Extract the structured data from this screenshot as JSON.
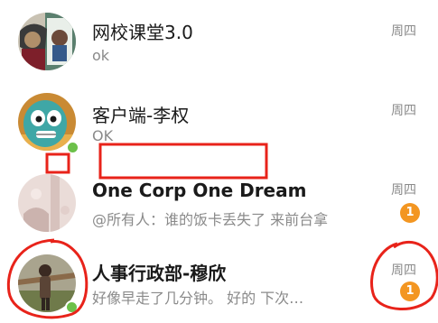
{
  "conversations": [
    {
      "name": "网校课堂3.0",
      "preview": "ok",
      "time": "周四",
      "online": false,
      "unread": null
    },
    {
      "name": "客户端-李权",
      "preview": "OK",
      "time": "周四",
      "online": true,
      "unread": null
    },
    {
      "name": "One Corp One Dream",
      "preview": "@所有人：谁的饭卡丢失了 来前台拿",
      "time": "周四",
      "online": false,
      "unread": "1"
    },
    {
      "name": "人事行政部-穆欣",
      "preview": "好像早走了几分钟。   好的  下次…",
      "time": "周四",
      "online": true,
      "unread": "1"
    }
  ],
  "colors": {
    "accent_badge": "#f39622",
    "online": "#6cc04a",
    "annotation": "#e8231a"
  }
}
